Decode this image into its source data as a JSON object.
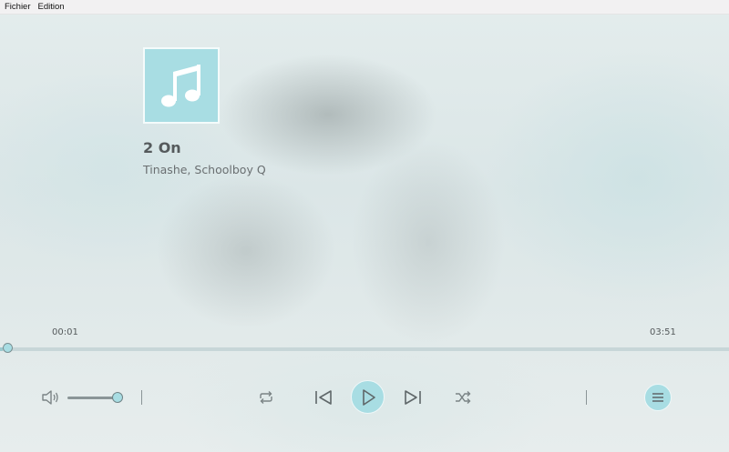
{
  "menubar": {
    "items": [
      {
        "label": "Fichier"
      },
      {
        "label": "Edition"
      }
    ]
  },
  "track": {
    "title": "2 On",
    "artist": "Tinashe, Schoolboy Q",
    "album_art_icon": "music-note-icon"
  },
  "playback": {
    "current_time": "00:01",
    "total_time": "03:51",
    "progress_fraction": 0.004,
    "volume_fraction": 0.85,
    "state": "paused"
  },
  "controls": {
    "volume_icon": "speaker-icon",
    "repeat_icon": "repeat-icon",
    "previous_icon": "skip-previous-icon",
    "play_icon": "play-icon",
    "next_icon": "skip-next-icon",
    "shuffle_icon": "shuffle-icon",
    "menu_icon": "hamburger-menu-icon"
  },
  "colors": {
    "accent": "#a8dde3",
    "icon": "#7a8385",
    "text": "#555a5c"
  }
}
